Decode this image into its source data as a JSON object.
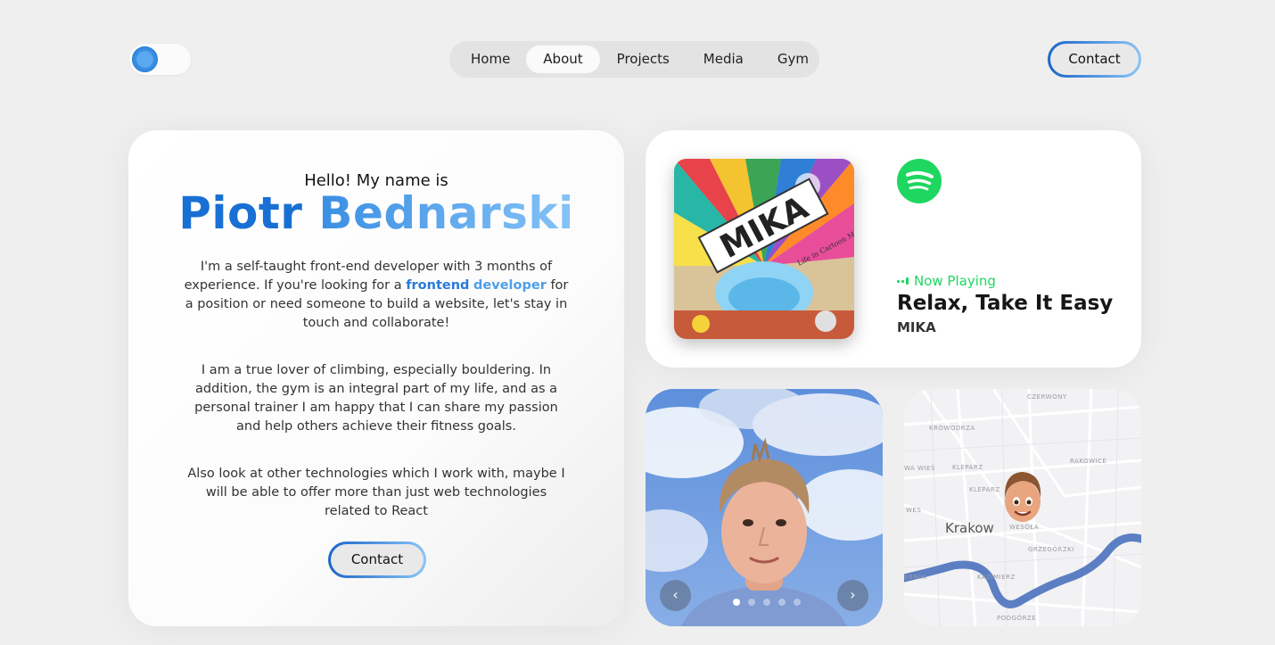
{
  "header": {
    "nav": [
      {
        "label": "Home",
        "active": false
      },
      {
        "label": "About",
        "active": true
      },
      {
        "label": "Projects",
        "active": false
      },
      {
        "label": "Media",
        "active": false
      },
      {
        "label": "Gym",
        "active": false
      }
    ],
    "contact_label": "Contact"
  },
  "about": {
    "greeting": "Hello! My name is",
    "first_name": "Piotr",
    "last_name": "Bednarski",
    "p1_before": "I'm a self-taught front-end developer with 3 months of experience. If you're looking for a ",
    "p1_highlight_1": "frontend",
    "p1_highlight_2": "developer",
    "p1_after": " for a position or need someone to build a website, let's stay in touch and collaborate!",
    "p2": "I am a true lover of climbing, especially bouldering. In addition, the gym is an integral part of my life, and as a personal trainer I am happy that I can share my passion and help others achieve their fitness goals.",
    "p3": "Also look at other technologies which I work with, maybe I will be able to offer more than just web technologies related to React",
    "contact_label": "Contact"
  },
  "spotify": {
    "status": "Now Playing",
    "song": "Relax, Take It Easy",
    "artist": "MIKA",
    "album_text": "MIKA",
    "album_subtitle": "Life in Cartoon Motion",
    "brand_color": "#1ed760"
  },
  "photo_carousel": {
    "slide_count": 5,
    "active_index": 0,
    "prev_icon": "chevron-left-icon",
    "next_icon": "chevron-right-icon"
  },
  "map": {
    "city": "Krakow",
    "labels": {
      "czerwony": "CZERWONY",
      "krowodrza": "KROWODRZA",
      "rakowice": "RAKOWICE",
      "wawies": "WA WIEŚ",
      "kleparz": "KLEPARZ",
      "kleparz2": "KLEPARZ",
      "wes": "WES",
      "wesola": "WESOŁA",
      "grzegorzki": "GRZEGÓRZKI",
      "debniki": "ĘBNIKI",
      "kazimierz": "KAZIMIERZ",
      "podgorze": "PODGÓRZE"
    }
  },
  "colors": {
    "accent_dark": "#1970d4",
    "accent_light": "#86c3f6",
    "spotify_green": "#1ed760"
  }
}
